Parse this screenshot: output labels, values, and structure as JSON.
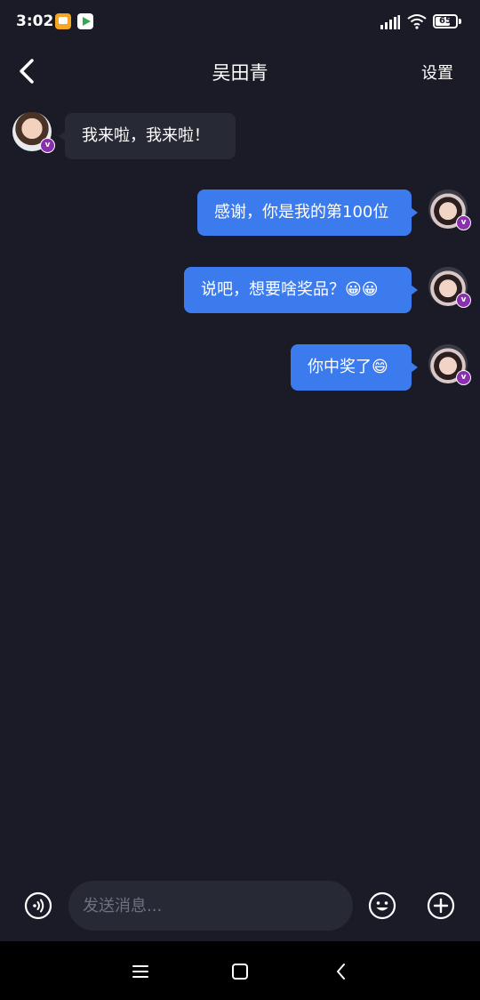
{
  "status_bar": {
    "time": "3:02",
    "battery": "65",
    "battery_level": 0.65,
    "icons": [
      "message-notification-icon",
      "play-store-icon",
      "signal-icon",
      "wifi-icon",
      "battery-icon"
    ]
  },
  "header": {
    "title": "吴田青",
    "settings_label": "设置",
    "back_icon": "chevron-left-icon"
  },
  "messages": [
    {
      "direction": "incoming",
      "text": "我来啦，我来啦！",
      "avatar_badge": "v"
    },
    {
      "direction": "outgoing",
      "text": "感谢，你是我的第100位",
      "avatar_badge": "v"
    },
    {
      "direction": "outgoing",
      "text": "说吧，想要啥奖品？😀😀",
      "avatar_badge": "v"
    },
    {
      "direction": "outgoing",
      "text": "你中奖了😄",
      "avatar_badge": "v"
    }
  ],
  "input_bar": {
    "placeholder": "发送消息...",
    "icons": [
      "voice-icon",
      "emoji-icon",
      "add-icon"
    ]
  },
  "nav_bar": {
    "icons": [
      "menu-icon",
      "home-icon",
      "back-icon"
    ]
  },
  "colors": {
    "background": "#1a1b26",
    "incoming_bubble": "#272935",
    "outgoing_bubble": "#3c7bee",
    "badge": "#8a2fae"
  }
}
